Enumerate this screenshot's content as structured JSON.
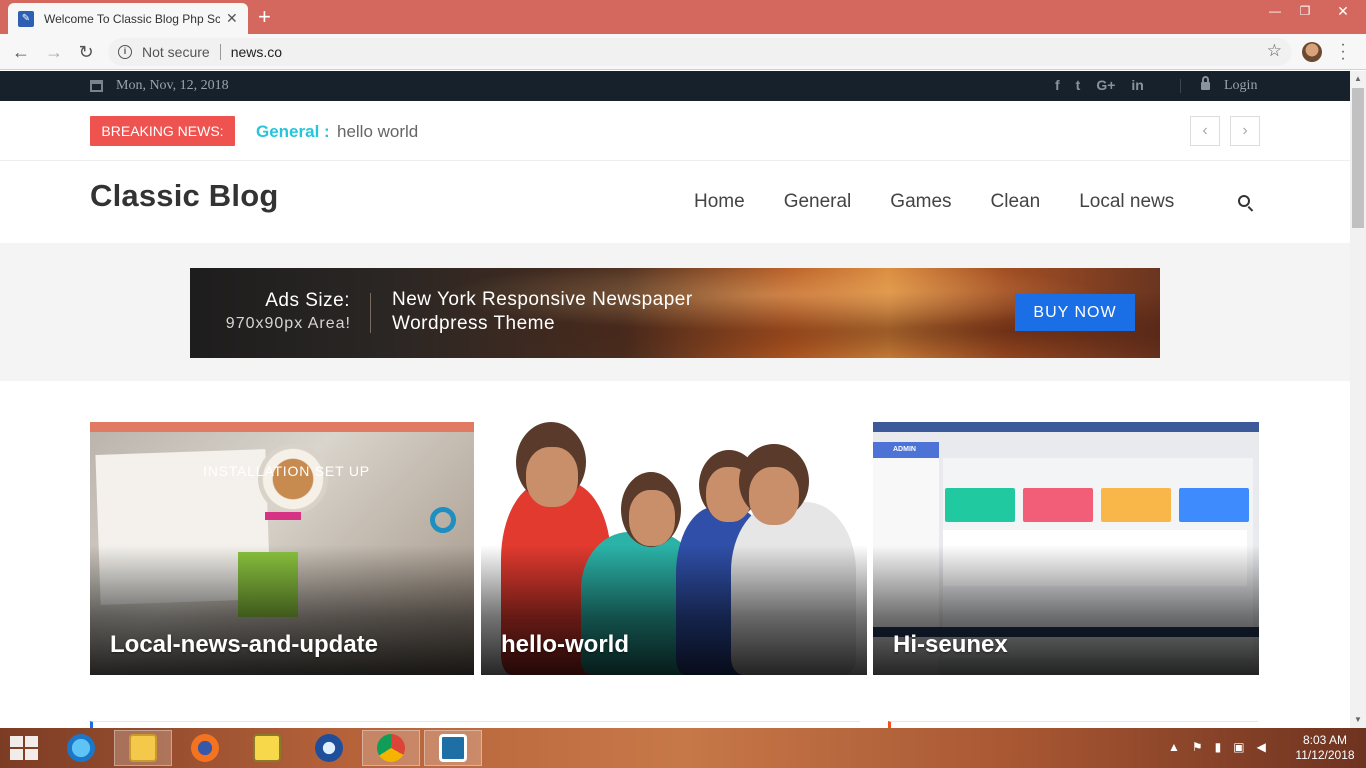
{
  "browser": {
    "tab_title": "Welcome To Classic Blog Php Sc",
    "new_tab": "+",
    "not_secure": "Not secure",
    "url": "news.co"
  },
  "topbar": {
    "date": "Mon, Nov, 12, 2018",
    "socials": [
      "f",
      "t",
      "G+",
      "in"
    ],
    "login": "Login"
  },
  "breaking": {
    "label": "BREAKING NEWS:",
    "category": "General :",
    "text": "hello world",
    "prev": "‹",
    "next": "›"
  },
  "header": {
    "logo": "Classic Blog",
    "nav": [
      "Home",
      "General",
      "Games",
      "Clean",
      "Local news"
    ]
  },
  "ad": {
    "size_label": "Ads Size:",
    "area": "970x90px Area!",
    "headline_1": "New York Responsive Newspaper",
    "headline_2": "Wordpress Theme",
    "button": "BUY NOW"
  },
  "cards": [
    {
      "title": "Local-news-and-update",
      "overlay": "INSTALLATION SET UP"
    },
    {
      "title": "hello-world"
    },
    {
      "title": "Hi-seunex",
      "overlay": "ADMIN"
    }
  ],
  "taskbar": {
    "time": "8:03 AM",
    "date": "11/12/2018"
  },
  "colors": {
    "tabstrip": "#d4685f",
    "topbar": "#17212b",
    "breaking_label": "#ef5350",
    "breaking_category": "#26c6da",
    "buy_button": "#1a6ee6"
  }
}
